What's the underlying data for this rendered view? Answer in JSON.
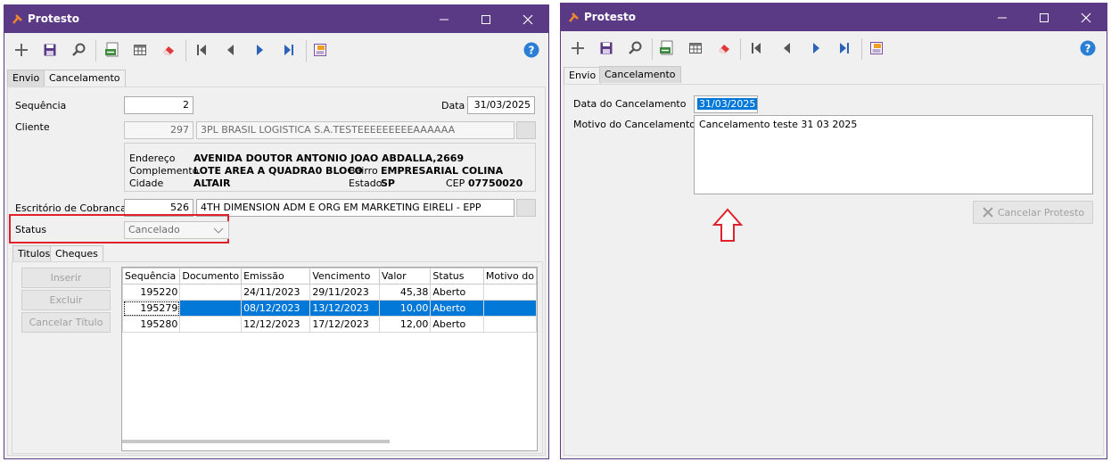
{
  "left_window": {
    "title": "Protesto",
    "tabs": [
      "Envio",
      "Cancelamento"
    ],
    "form": {
      "sequencia_label": "Sequência",
      "sequencia_value": "2",
      "data_label": "Data",
      "data_value": "31/03/2025",
      "cliente_label": "Cliente",
      "cliente_code": "297",
      "cliente_name": "3PL BRASIL LOGISTICA S.A.TESTEEEEEEEEEAAAAAA",
      "endereco_label": "Endereço",
      "endereco_value": "AVENIDA DOUTOR ANTONIO JOAO ABDALLA,2669",
      "complemento_label": "Complemento",
      "complemento_value": "LOTE AREA A QUADRA0 BLOCO",
      "bairro_label": "Bairro",
      "bairro_value": "EMPRESARIAL COLINA",
      "cidade_label": "Cidade",
      "cidade_value": "ALTAIR",
      "estado_label": "Estado",
      "estado_value": "SP",
      "cep_label": "CEP",
      "cep_value": "07750020",
      "escritorio_label": "Escritório de Cobranca",
      "escritorio_code": "526",
      "escritorio_name": "4TH DIMENSION ADM E ORG EM MARKETING EIRELI - EPP",
      "status_label": "Status",
      "status_value": "Cancelado"
    },
    "subtabs": [
      "Titulos",
      "Cheques"
    ],
    "buttons": {
      "inserir": "Inserir",
      "excluir": "Excluir",
      "cancelar_titulo": "Cancelar Título"
    },
    "grid": {
      "columns": [
        "Sequência",
        "Documento",
        "Emissão",
        "Vencimento",
        "Valor",
        "Status",
        "Motivo do"
      ],
      "rows": [
        {
          "seq": "195220",
          "doc": "",
          "emissao": "24/11/2023",
          "vencimento": "29/11/2023",
          "valor": "45,38",
          "status": "Aberto",
          "motivo": ""
        },
        {
          "seq": "195279",
          "doc": "",
          "emissao": "08/12/2023",
          "vencimento": "13/12/2023",
          "valor": "10,00",
          "status": "Aberto",
          "motivo": ""
        },
        {
          "seq": "195280",
          "doc": "",
          "emissao": "12/12/2023",
          "vencimento": "17/12/2023",
          "valor": "12,00",
          "status": "Aberto",
          "motivo": ""
        }
      ]
    }
  },
  "right_window": {
    "title": "Protesto",
    "tabs": [
      "Envio",
      "Cancelamento"
    ],
    "form": {
      "data_cancel_label": "Data do Cancelamento",
      "data_cancel_value": "31/03/2025",
      "motivo_label": "Motivo do Cancelamento",
      "motivo_value": "Cancelamento teste 31 03 2025",
      "cancel_button": "Cancelar Protesto"
    }
  },
  "colors": {
    "titlebar": "#5b3a85",
    "highlight_box": "#e0202a",
    "selection": "#0078d7",
    "arrow": "#e0202a",
    "help_icon": "#2a7fd4",
    "nav_icon": "#2c63b8"
  }
}
